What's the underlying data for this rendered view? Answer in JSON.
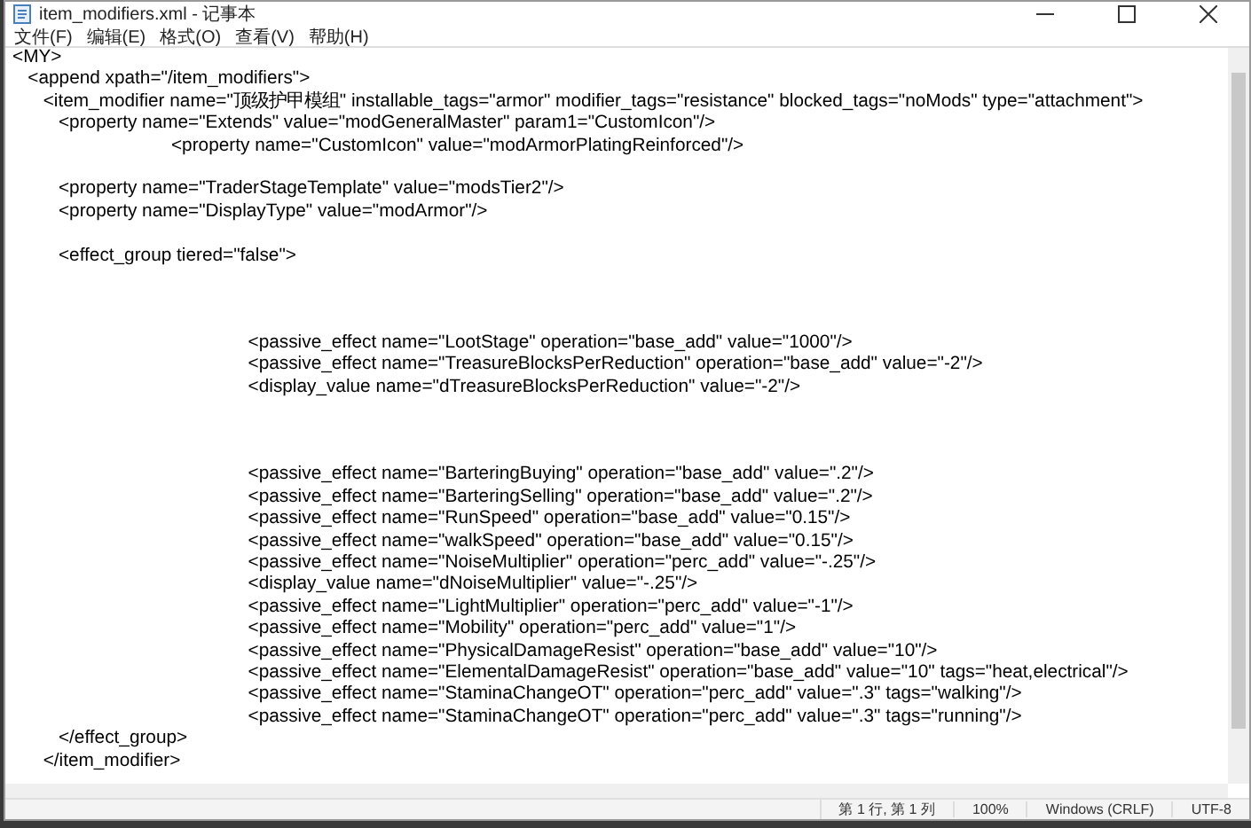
{
  "window": {
    "title": "item_modifiers.xml - 记事本"
  },
  "menu": [
    "文件(F)",
    "编辑(E)",
    "格式(O)",
    "查看(V)",
    "帮助(H)"
  ],
  "editor": {
    "lines": [
      {
        "kind": "text",
        "text": "<MY>"
      },
      {
        "kind": "text",
        "text": "   <append xpath=\"/item_modifiers\">"
      },
      {
        "kind": "text",
        "text": "      <item_modifier name=\"顶级护甲模组\" installable_tags=\"armor\" modifier_tags=\"resistance\" blocked_tags=\"noMods\" type=\"attachment\">"
      },
      {
        "kind": "text",
        "text": "         <property name=\"Extends\" value=\"modGeneralMaster\" param1=\"CustomIcon\"/>"
      },
      {
        "kind": "text",
        "text": "                               <property name=\"CustomIcon\" value=\"modArmorPlatingReinforced\"/>"
      },
      {
        "kind": "blank"
      },
      {
        "kind": "text",
        "text": "         <property name=\"TraderStageTemplate\" value=\"modsTier2\"/>"
      },
      {
        "kind": "text",
        "text": "         <property name=\"DisplayType\" value=\"modArmor\"/>"
      },
      {
        "kind": "blank"
      },
      {
        "kind": "text",
        "text": "         <effect_group tiered=\"false\">"
      },
      {
        "kind": "blank"
      },
      {
        "kind": "blank"
      },
      {
        "kind": "blank"
      },
      {
        "kind": "text",
        "text": "                                              <passive_effect name=\"LootStage\" operation=\"base_add\" value=\"1000\"/>"
      },
      {
        "kind": "text",
        "text": "                                              <passive_effect name=\"TreasureBlocksPerReduction\" operation=\"base_add\" value=\"-2\"/>"
      },
      {
        "kind": "text",
        "text": "                                              <display_value name=\"dTreasureBlocksPerReduction\" value=\"-2\"/>"
      },
      {
        "kind": "blank"
      },
      {
        "kind": "blank"
      },
      {
        "kind": "blank"
      },
      {
        "kind": "text",
        "text": "                                              <passive_effect name=\"BarteringBuying\" operation=\"base_add\" value=\".2\"/>"
      },
      {
        "kind": "text",
        "text": "                                              <passive_effect name=\"BarteringSelling\" operation=\"base_add\" value=\".2\"/>"
      },
      {
        "kind": "text",
        "text": "                                              <passive_effect name=\"RunSpeed\" operation=\"base_add\" value=\"0.15\"/>"
      },
      {
        "kind": "text",
        "text": "                                              <passive_effect name=\"walkSpeed\" operation=\"base_add\" value=\"0.15\"/>"
      },
      {
        "kind": "text",
        "text": "                                              <passive_effect name=\"NoiseMultiplier\" operation=\"perc_add\" value=\"-.25\"/>"
      },
      {
        "kind": "text",
        "text": "                                              <display_value name=\"dNoiseMultiplier\" value=\"-.25\"/>"
      },
      {
        "kind": "text",
        "text": "                                              <passive_effect name=\"LightMultiplier\" operation=\"perc_add\" value=\"-1\"/>"
      },
      {
        "kind": "text",
        "text": "                                              <passive_effect name=\"Mobility\" operation=\"perc_add\" value=\"1\"/>"
      },
      {
        "kind": "text",
        "text": "                                              <passive_effect name=\"PhysicalDamageResist\" operation=\"base_add\" value=\"10\"/>"
      },
      {
        "kind": "text",
        "text": "                                              <passive_effect name=\"ElementalDamageResist\" operation=\"base_add\" value=\"10\" tags=\"heat,electrical\"/>"
      },
      {
        "kind": "text",
        "text": "                                              <passive_effect name=\"StaminaChangeOT\" operation=\"perc_add\" value=\".3\" tags=\"walking\"/>"
      },
      {
        "kind": "text",
        "text": "                                              <passive_effect name=\"StaminaChangeOT\" operation=\"perc_add\" value=\".3\" tags=\"running\"/>"
      },
      {
        "kind": "text",
        "text": "         </effect_group>"
      },
      {
        "kind": "text",
        "text": "      </item_modifier>"
      }
    ]
  },
  "status_bar": [
    "第 1 行, 第 1 列",
    "100%",
    "Windows (CRLF)",
    "UTF-8"
  ]
}
